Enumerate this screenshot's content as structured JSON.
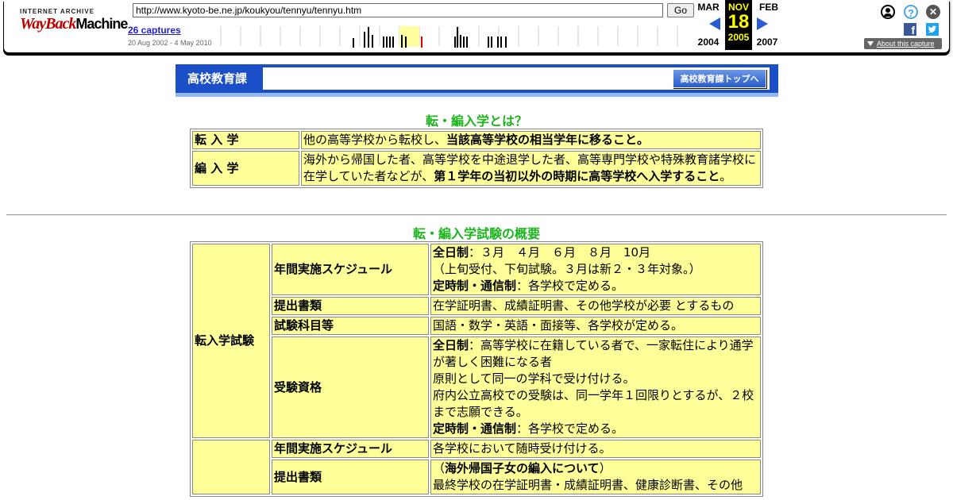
{
  "toolbar": {
    "logo_top": "INTERNET ARCHIVE",
    "logo_main": "WayBack",
    "logo_tail": "Machine",
    "url": "http://www.kyoto-be.ne.jp/koukyou/tennyu/tennyu.htm",
    "go_label": "Go",
    "captures": "26 captures",
    "range": "20 Aug 2002 - 4 May 2010",
    "prev_month": "MAR",
    "cur_month": "NOV",
    "next_month": "FEB",
    "cur_day": "18",
    "prev_year": "2004",
    "cur_year": "2005",
    "next_year": "2007",
    "about_label": "About this capture",
    "help_glyph": "?",
    "close_glyph": "✕",
    "fb_glyph": "f",
    "tw_glyph": "🐦"
  },
  "banner": {
    "title": "高校教育課",
    "top_button": "高校教育課トップへ"
  },
  "section1": {
    "heading": "転・編入学とは？",
    "rows": [
      {
        "label": "転 入 学",
        "text_a": "他の高等学校から転校し、",
        "text_b": "当該高等学校の相当学年に移ること。",
        "text_c": ""
      },
      {
        "label": "編 入 学",
        "text_a": "海外から帰国した者、高等学校を中途退学した者、高等専門学校や特殊教育諸学校に在学していた者などが、",
        "text_b": "第１学年の当初以外の時期に高等学校へ入学すること",
        "text_c": "。"
      }
    ]
  },
  "section2": {
    "heading": "転・編入学試験の概要",
    "group1_label": "転入学試験",
    "g1": {
      "schedule_label": "年間実施スケジュール",
      "schedule_b1": "全日制",
      "schedule_t1": "：３月　４月　６月　８月　10月",
      "schedule_t2": "（上旬受付、下旬試験。３月は新２・３年対象。）",
      "schedule_b2": "定時制・通信制",
      "schedule_t3": "：各学校で定める。",
      "docs_label": "提出書類",
      "docs_text": "在学証明書、成績証明書、その他学校が必要 とするもの",
      "subjects_label": "試験科目等",
      "subjects_text": "国語・数学・英語・面接等、各学校が定める。",
      "elig_label": "受験資格",
      "elig_b1": "全日制",
      "elig_t1": "：高等学校に在籍している者で、一家転住により通学が著しく困難になる者",
      "elig_t2": "原則として同一の学科で受け付ける。",
      "elig_t3": "府内公立高校での受験は、同一学年１回限りとするが、２校まで志願できる。",
      "elig_b2": "定時制・通信制",
      "elig_t4": "：各学校で定める。"
    },
    "g2": {
      "schedule_label": "年間実施スケジュール",
      "schedule_text": "各学校において随時受け付ける。",
      "docs_label": "提出書類",
      "docs_p1": "（",
      "docs_b1": "海外帰国子女の編入について",
      "docs_p2": "）",
      "docs_text": "最終学校の在学証明書・成績証明書、健康診断書、その他"
    }
  }
}
